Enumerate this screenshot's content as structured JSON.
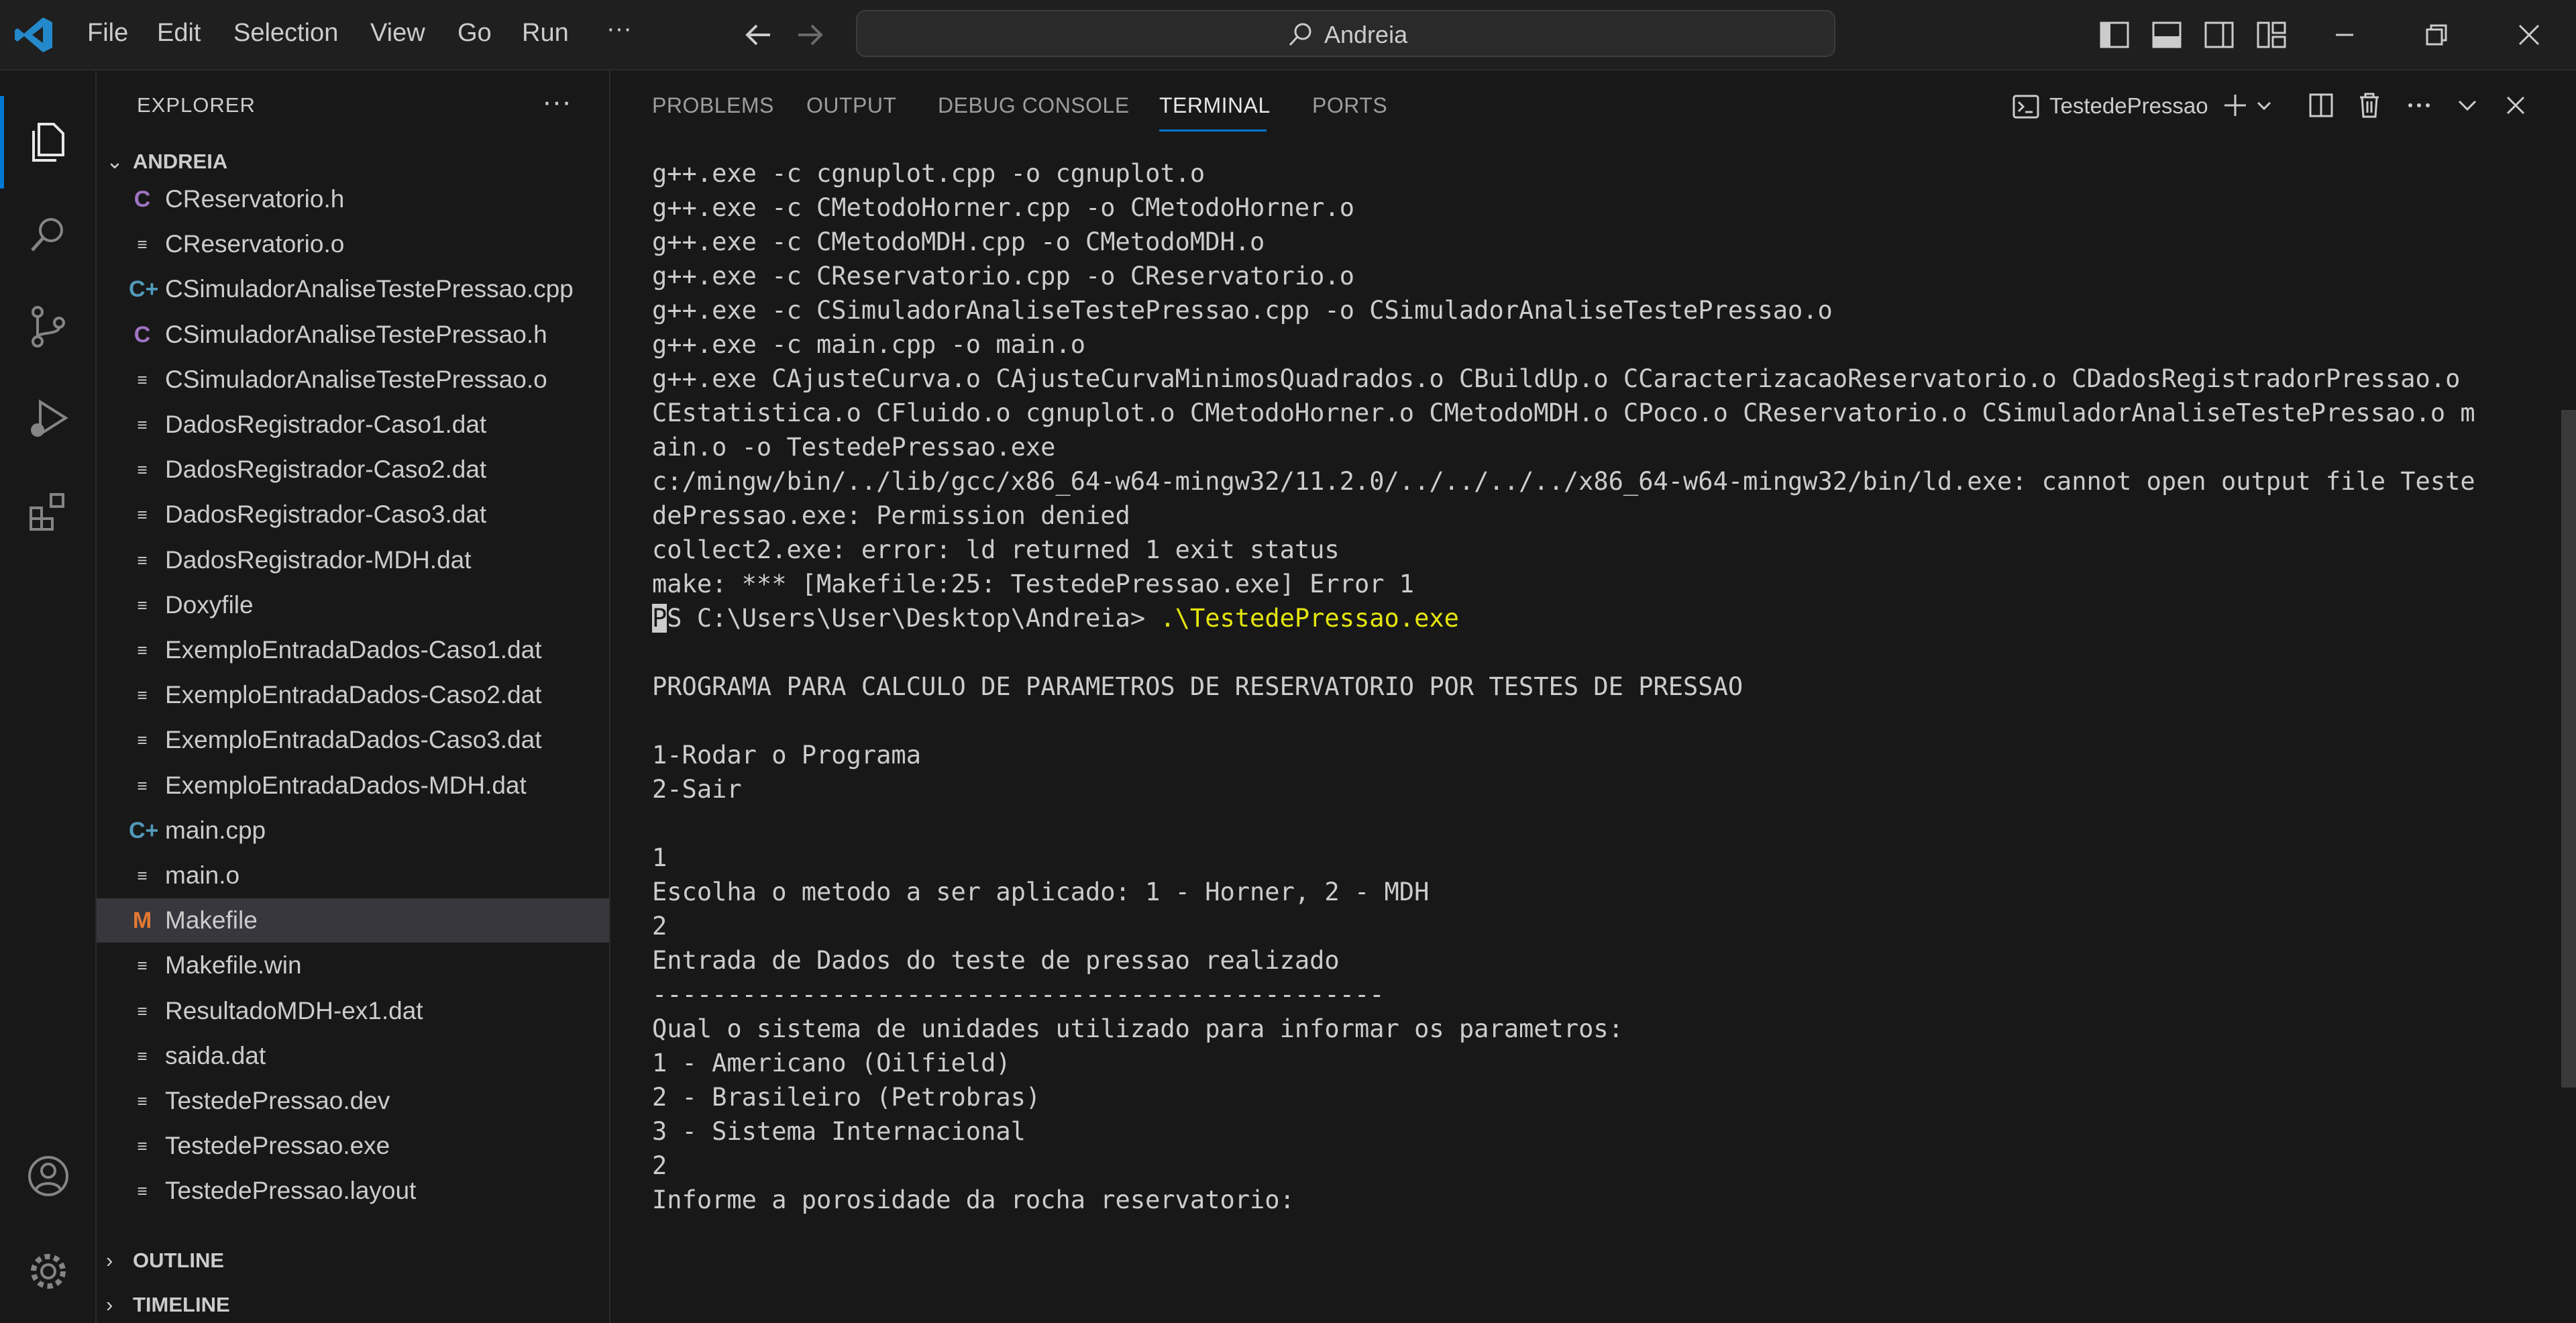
{
  "menu": [
    "File",
    "Edit",
    "Selection",
    "View",
    "Go",
    "Run",
    "···"
  ],
  "command_center": {
    "text": "Andreia"
  },
  "sidebar": {
    "title": "EXPLORER",
    "more": "···",
    "folder": "ANDREIA",
    "files": [
      {
        "name": "CReservatorio.h",
        "icon": "C"
      },
      {
        "name": "CReservatorio.o",
        "icon": "≡"
      },
      {
        "name": "CSimuladorAnaliseTestePressao.cpp",
        "icon": "C+"
      },
      {
        "name": "CSimuladorAnaliseTestePressao.h",
        "icon": "C"
      },
      {
        "name": "CSimuladorAnaliseTestePressao.o",
        "icon": "≡"
      },
      {
        "name": "DadosRegistrador-Caso1.dat",
        "icon": "≡"
      },
      {
        "name": "DadosRegistrador-Caso2.dat",
        "icon": "≡"
      },
      {
        "name": "DadosRegistrador-Caso3.dat",
        "icon": "≡"
      },
      {
        "name": "DadosRegistrador-MDH.dat",
        "icon": "≡"
      },
      {
        "name": "Doxyfile",
        "icon": "≡"
      },
      {
        "name": "ExemploEntradaDados-Caso1.dat",
        "icon": "≡"
      },
      {
        "name": "ExemploEntradaDados-Caso2.dat",
        "icon": "≡"
      },
      {
        "name": "ExemploEntradaDados-Caso3.dat",
        "icon": "≡"
      },
      {
        "name": "ExemploEntradaDados-MDH.dat",
        "icon": "≡"
      },
      {
        "name": "main.cpp",
        "icon": "C+"
      },
      {
        "name": "main.o",
        "icon": "≡"
      },
      {
        "name": "Makefile",
        "icon": "M"
      },
      {
        "name": "Makefile.win",
        "icon": "≡"
      },
      {
        "name": "ResultadoMDH-ex1.dat",
        "icon": "≡"
      },
      {
        "name": "saida.dat",
        "icon": "≡"
      },
      {
        "name": "TestedePressao.dev",
        "icon": "≡"
      },
      {
        "name": "TestedePressao.exe",
        "icon": "≡"
      },
      {
        "name": "TestedePressao.layout",
        "icon": "≡"
      }
    ],
    "outline": "OUTLINE",
    "timeline": "TIMELINE"
  },
  "panel": {
    "tabs": [
      "PROBLEMS",
      "OUTPUT",
      "DEBUG CONSOLE",
      "TERMINAL",
      "PORTS"
    ],
    "terminal_name": "TestedePressao",
    "lines": [
      "g++.exe -c cgnuplot.cpp -o cgnuplot.o",
      "g++.exe -c CMetodoHorner.cpp -o CMetodoHorner.o",
      "g++.exe -c CMetodoMDH.cpp -o CMetodoMDH.o",
      "g++.exe -c CReservatorio.cpp -o CReservatorio.o",
      "g++.exe -c CSimuladorAnaliseTestePressao.cpp -o CSimuladorAnaliseTestePressao.o",
      "g++.exe -c main.cpp -o main.o",
      "g++.exe CAjusteCurva.o CAjusteCurvaMinimosQuadrados.o CBuildUp.o CCaracterizacaoReservatorio.o CDadosRegistradorPressao.o",
      "CEstatistica.o CFluido.o cgnuplot.o CMetodoHorner.o CMetodoMDH.o CPoco.o CReservatorio.o CSimuladorAnaliseTestePressao.o m",
      "ain.o -o TestedePressao.exe",
      "c:/mingw/bin/../lib/gcc/x86_64-w64-mingw32/11.2.0/../../../../x86_64-w64-mingw32/bin/ld.exe: cannot open output file Teste",
      "dePressao.exe: Permission denied",
      "collect2.exe: error: ld returned 1 exit status",
      "make: *** [Makefile:25: TestedePressao.exe] Error 1"
    ],
    "prompt": "PS C:\\Users\\User\\Desktop\\Andreia> ",
    "command": ".\\TestedePressao.exe",
    "output": [
      "",
      "PROGRAMA PARA CALCULO DE PARAMETROS DE RESERVATORIO POR TESTES DE PRESSAO",
      "",
      "1-Rodar o Programa",
      "2-Sair",
      "",
      "1",
      "Escolha o metodo a ser aplicado: 1 - Horner, 2 - MDH",
      "2",
      "Entrada de Dados do teste de pressao realizado",
      "-------------------------------------------------",
      "Qual o sistema de unidades utilizado para informar os parametros:",
      "1 - Americano (Oilfield)",
      "2 - Brasileiro (Petrobras)",
      "3 - Sistema Internacional",
      "2",
      "Informe a porosidade da rocha reservatorio:"
    ]
  },
  "colors": {
    "accent": "#0078d4",
    "background": "#181818",
    "sidebar_selected": "#37373d",
    "terminal_command": "#e5e510"
  }
}
